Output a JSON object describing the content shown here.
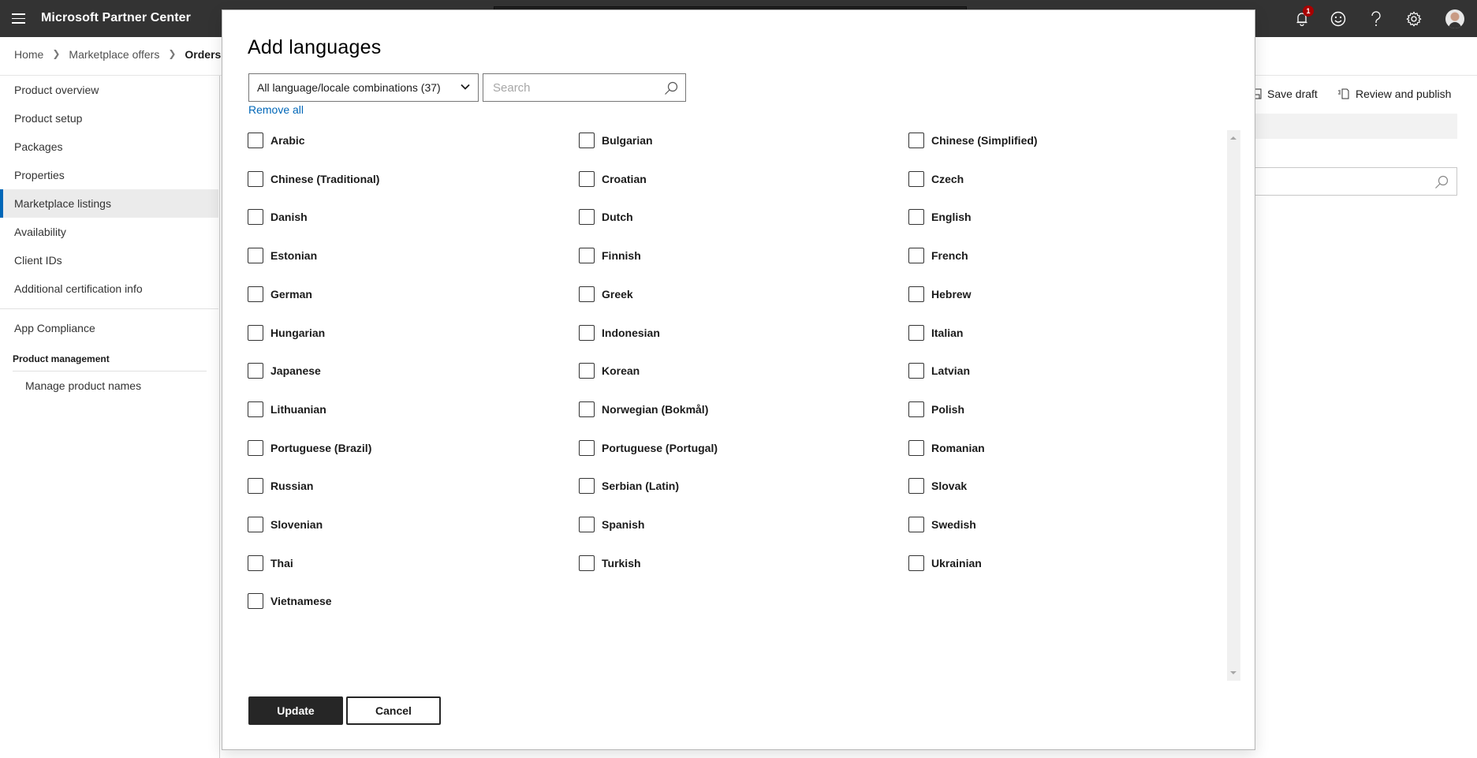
{
  "header": {
    "app_title": "Microsoft Partner Center",
    "notification_count": "1",
    "icons": [
      "hamburger-menu-icon",
      "bell-icon",
      "smiley-feedback-icon",
      "help-icon",
      "gear-icon",
      "avatar"
    ]
  },
  "breadcrumb": [
    {
      "label": "Home"
    },
    {
      "label": "Marketplace offers"
    },
    {
      "label": "Orders A"
    }
  ],
  "sidebar": {
    "items": [
      {
        "label": "Product overview",
        "selected": false
      },
      {
        "label": "Product setup",
        "selected": false
      },
      {
        "label": "Packages",
        "selected": false
      },
      {
        "label": "Properties",
        "selected": false
      },
      {
        "label": "Marketplace listings",
        "selected": true
      },
      {
        "label": "Availability",
        "selected": false
      },
      {
        "label": "Client IDs",
        "selected": false
      },
      {
        "label": "Additional certification info",
        "selected": false
      }
    ],
    "compliance_item": {
      "label": "App Compliance"
    },
    "group_heading": "Product management",
    "group_items": [
      {
        "label": "Manage product names"
      }
    ]
  },
  "background_commands": {
    "save_draft": "Save draft",
    "review_publish": "Review and publish"
  },
  "modal": {
    "title": "Add languages",
    "filter_select_value": "All language/locale combinations (37)",
    "search_placeholder": "Search",
    "search_value": "",
    "remove_all": "Remove all",
    "languages": [
      {
        "label": "Arabic",
        "checked": false
      },
      {
        "label": "Bulgarian",
        "checked": false
      },
      {
        "label": "Chinese (Simplified)",
        "checked": false
      },
      {
        "label": "Chinese (Traditional)",
        "checked": false
      },
      {
        "label": "Croatian",
        "checked": false
      },
      {
        "label": "Czech",
        "checked": false
      },
      {
        "label": "Danish",
        "checked": false
      },
      {
        "label": "Dutch",
        "checked": false
      },
      {
        "label": "English",
        "checked": false
      },
      {
        "label": "Estonian",
        "checked": false
      },
      {
        "label": "Finnish",
        "checked": false
      },
      {
        "label": "French",
        "checked": false
      },
      {
        "label": "German",
        "checked": false
      },
      {
        "label": "Greek",
        "checked": false
      },
      {
        "label": "Hebrew",
        "checked": false
      },
      {
        "label": "Hungarian",
        "checked": false
      },
      {
        "label": "Indonesian",
        "checked": false
      },
      {
        "label": "Italian",
        "checked": false
      },
      {
        "label": "Japanese",
        "checked": false
      },
      {
        "label": "Korean",
        "checked": false
      },
      {
        "label": "Latvian",
        "checked": false
      },
      {
        "label": "Lithuanian",
        "checked": false
      },
      {
        "label": "Norwegian (Bokmål)",
        "checked": false
      },
      {
        "label": "Polish",
        "checked": false
      },
      {
        "label": "Portuguese (Brazil)",
        "checked": false
      },
      {
        "label": "Portuguese (Portugal)",
        "checked": false
      },
      {
        "label": "Romanian",
        "checked": false
      },
      {
        "label": "Russian",
        "checked": false
      },
      {
        "label": "Serbian (Latin)",
        "checked": false
      },
      {
        "label": "Slovak",
        "checked": false
      },
      {
        "label": "Slovenian",
        "checked": false
      },
      {
        "label": "Spanish",
        "checked": false
      },
      {
        "label": "Swedish",
        "checked": false
      },
      {
        "label": "Thai",
        "checked": false
      },
      {
        "label": "Turkish",
        "checked": false
      },
      {
        "label": "Ukrainian",
        "checked": false
      },
      {
        "label": "Vietnamese",
        "checked": false
      }
    ],
    "update_button": "Update",
    "cancel_button": "Cancel"
  },
  "colors": {
    "topbar": "#333333",
    "accent": "#0067b8",
    "badge": "#a80000",
    "primary_button": "#262626"
  }
}
